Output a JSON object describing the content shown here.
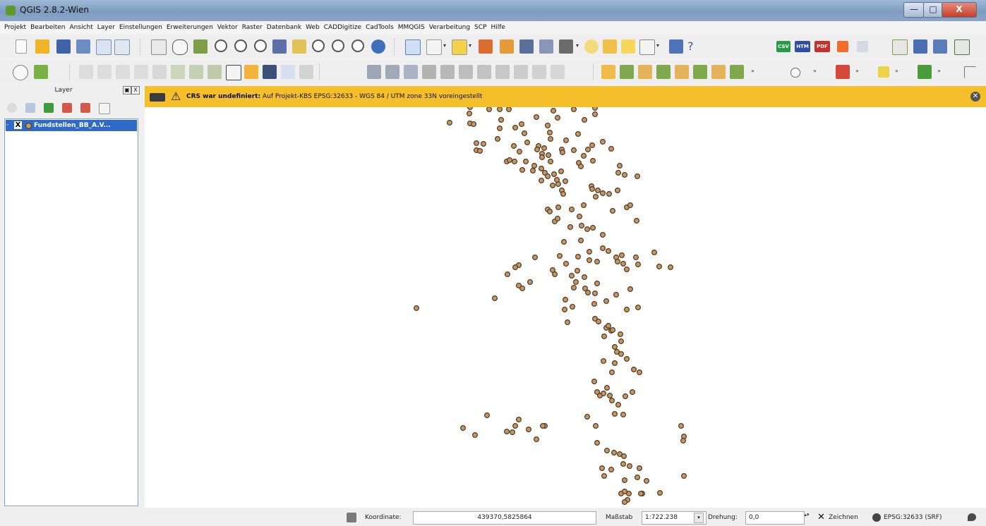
{
  "window": {
    "title": "QGIS 2.8.2-Wien",
    "min_glyph": "—",
    "max_glyph": "□",
    "close_glyph": "X"
  },
  "menu": [
    "Projekt",
    "Bearbeiten",
    "Ansicht",
    "Layer",
    "Einstellungen",
    "Erweiterungen",
    "Vektor",
    "Raster",
    "Datenbank",
    "Web",
    "CADDigitize",
    "CadTools",
    "MMQGIS",
    "Verarbeitung",
    "SCP",
    "Hilfe"
  ],
  "toolbar": {
    "csv_label": "CSV",
    "htm_label": "HTM",
    "pdf_label": "PDF",
    "more_glyph": "»",
    "help_glyph": "?"
  },
  "layers_panel": {
    "title": "Layer",
    "float_glyph": "▣",
    "close_glyph": "X",
    "layer": {
      "name": "Fundstellen_BB_A.V...",
      "checked_glyph": "X",
      "expander": "-"
    }
  },
  "message_bar": {
    "title": "CRS war undefiniert:",
    "text": "Auf Projekt-KBS EPSG:32633 - WGS 84 / UTM zone 33N voreingestellt",
    "warn_glyph": "⚠",
    "close_glyph": "✕"
  },
  "status": {
    "coord_label": "Koordinate:",
    "coord_value": "439370,5825864",
    "scale_label": "Maßstab",
    "scale_value": "1:722.238",
    "scale_arrow": "▾",
    "rotation_label": "Drehung:",
    "rotation_value": "0,0",
    "spin_glyph": "▴▾",
    "render_glyph": "✕",
    "render_label": "Zeichnen",
    "crs_label": "EPSG:32633 (SRF)"
  },
  "colors": {
    "message_bar": "#f5bf2c",
    "point_fill": "#c9965f",
    "point_stroke": "#4a3a28",
    "selection": "#3169c6"
  }
}
